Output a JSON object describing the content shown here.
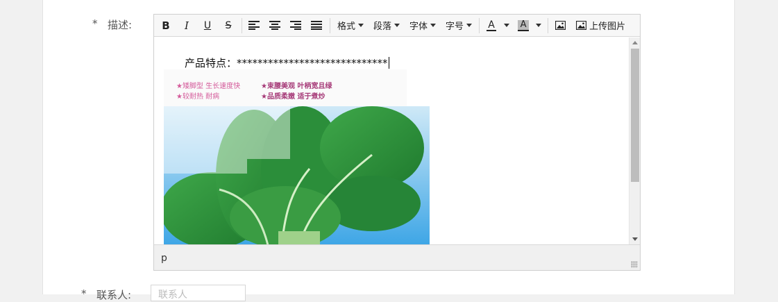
{
  "form": {
    "desc_required": "*",
    "desc_label": "描述:",
    "contact_required": "*",
    "contact_label": "联系人:",
    "contact_placeholder": "联系人"
  },
  "toolbar": {
    "bold": "B",
    "italic": "I",
    "underline": "U",
    "strike": "S",
    "format": "格式",
    "paragraph": "段落",
    "font": "字体",
    "size": "字号",
    "font_color": "A",
    "bg_color": "A",
    "upload_image": "上传图片"
  },
  "content": {
    "text": "产品特点：*****************************",
    "banner": {
      "line1_left": "★矮脚型 生长速度快",
      "line1_right": "★束腰美观  叶柄宽且绿",
      "line2_left": "★较耐热 耐病",
      "line2_right": "★品质柔嫩     适于煮炒"
    }
  },
  "status": {
    "path": "p"
  },
  "colors": {
    "accent_green": "#2f8f3a",
    "sky_blue": "#4aa9e6",
    "banner_pink": "#d45a9a"
  }
}
